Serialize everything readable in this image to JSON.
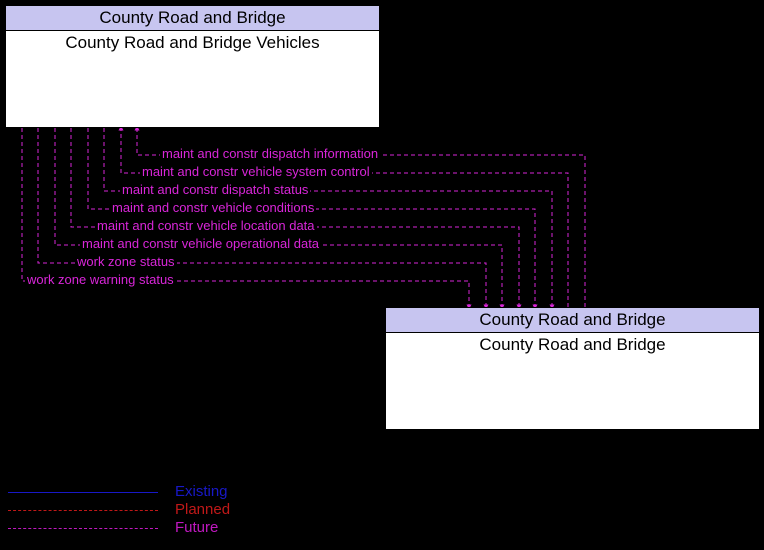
{
  "entities": {
    "top": {
      "header": "County Road and Bridge",
      "body": "County Road and Bridge Vehicles"
    },
    "bottom": {
      "header": "County Road and Bridge",
      "body": "County Road and Bridge"
    }
  },
  "flows": [
    "maint and constr dispatch information",
    "maint and constr vehicle system control",
    "maint and constr dispatch status",
    "maint and constr vehicle conditions",
    "maint and constr vehicle location data",
    "maint and constr vehicle operational data",
    "work zone status",
    "work zone warning status"
  ],
  "legend": {
    "existing": "Existing",
    "planned": "Planned",
    "future": "Future"
  },
  "colors": {
    "flow": "#d926d9",
    "header_bg": "#c7c5f0",
    "existing": "#1818c7",
    "planned": "#c01818",
    "future": "#c018c0"
  }
}
